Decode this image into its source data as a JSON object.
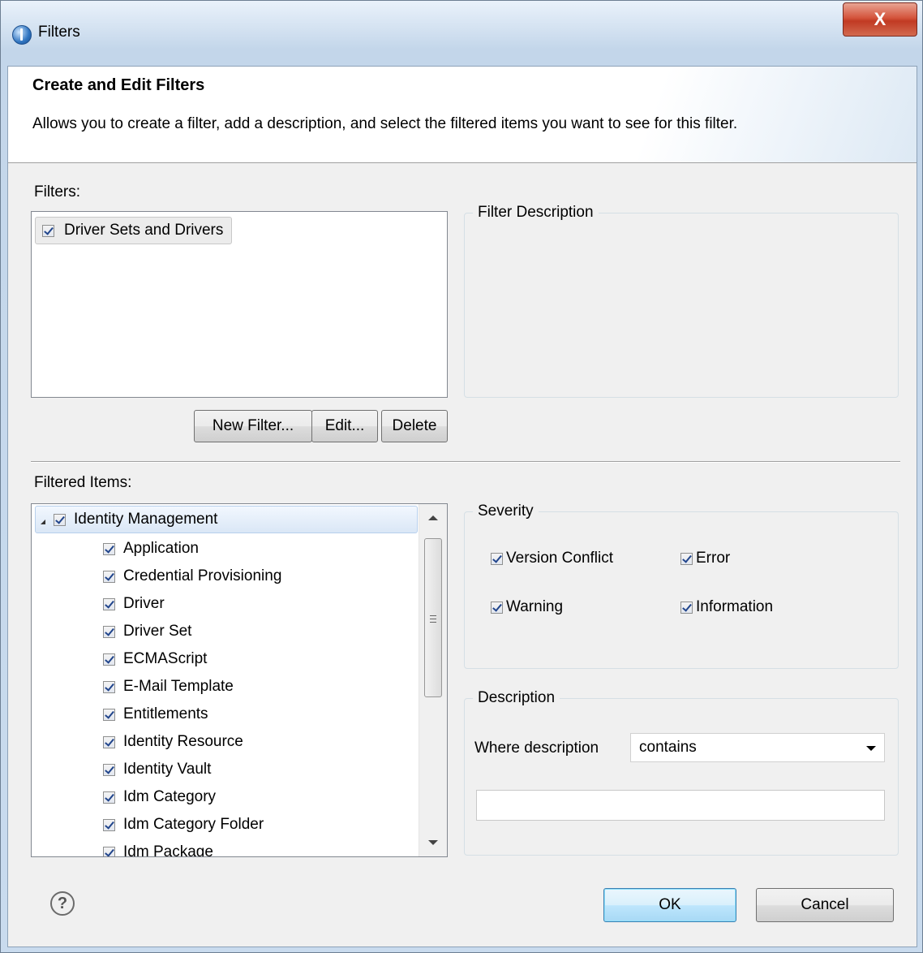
{
  "window": {
    "title": "Filters",
    "close_label": "X"
  },
  "header": {
    "title": "Create and Edit Filters",
    "description": "Allows you to create a filter, add a description, and select the filtered items you want to see for this filter."
  },
  "filters": {
    "label": "Filters:",
    "items": [
      {
        "label": "Driver Sets and Drivers",
        "checked": true
      }
    ],
    "buttons": {
      "new": "New Filter...",
      "edit": "Edit...",
      "delete": "Delete"
    }
  },
  "filter_description": {
    "title": "Filter Description"
  },
  "filtered_items": {
    "label": "Filtered Items:",
    "root": {
      "label": "Identity Management",
      "checked": true,
      "expanded": true
    },
    "children": [
      "Application",
      "Credential Provisioning",
      "Driver",
      "Driver Set",
      "ECMAScript",
      "E-Mail Template",
      "Entitlements",
      "Identity Resource",
      "Identity Vault",
      "Idm Category",
      "Idm Category Folder",
      "Idm Package"
    ]
  },
  "severity": {
    "title": "Severity",
    "options": [
      {
        "label": "Version Conflict",
        "checked": true
      },
      {
        "label": "Error",
        "checked": true
      },
      {
        "label": "Warning",
        "checked": true
      },
      {
        "label": "Information",
        "checked": true
      }
    ]
  },
  "description": {
    "title": "Description",
    "where_label": "Where description",
    "operator": "contains",
    "value": ""
  },
  "footer": {
    "ok": "OK",
    "cancel": "Cancel",
    "help_symbol": "?"
  }
}
